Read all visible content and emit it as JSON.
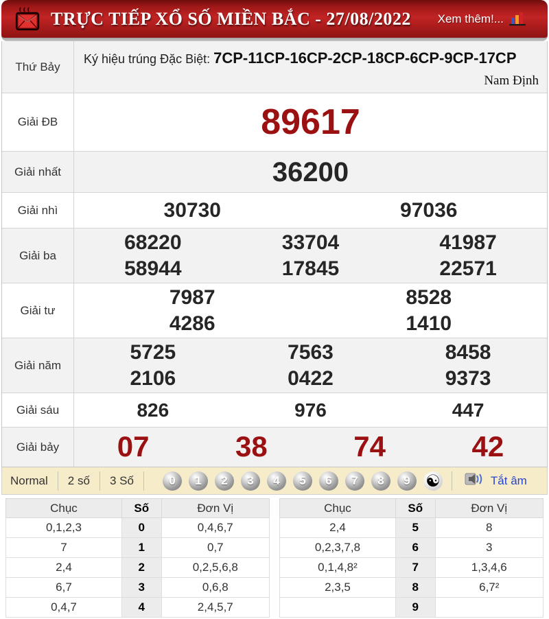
{
  "header": {
    "title": "TRỰC TIẾP XỔ SỐ MIỀN BẮC - 27/08/2022",
    "more_label": "Xem thêm!..."
  },
  "sign_row": {
    "day": "Thứ Bảy",
    "sign_label": "Ký hiệu trúng Đặc Biệt: ",
    "sign_codes": "7CP-11CP-16CP-2CP-18CP-6CP-9CP-17CP",
    "province": "Nam Định"
  },
  "prizes": {
    "db": {
      "label": "Giải ĐB",
      "values": [
        "89617"
      ]
    },
    "nhat": {
      "label": "Giải nhất",
      "values": [
        "36200"
      ]
    },
    "nhi": {
      "label": "Giải nhì",
      "values": [
        "30730",
        "97036"
      ]
    },
    "ba": {
      "label": "Giải ba",
      "values": [
        "68220",
        "33704",
        "41987",
        "58944",
        "17845",
        "22571"
      ]
    },
    "tu": {
      "label": "Giải tư",
      "values": [
        "7987",
        "8528",
        "4286",
        "1410"
      ]
    },
    "nam": {
      "label": "Giải năm",
      "values": [
        "5725",
        "7563",
        "8458",
        "2106",
        "0422",
        "9373"
      ]
    },
    "sau": {
      "label": "Giải sáu",
      "values": [
        "826",
        "976",
        "447"
      ]
    },
    "bay": {
      "label": "Giải bảy",
      "values": [
        "07",
        "38",
        "74",
        "42"
      ]
    }
  },
  "controls": {
    "modes": [
      "Normal",
      "2 số",
      "3 Số"
    ],
    "digits": [
      "0",
      "1",
      "2",
      "3",
      "4",
      "5",
      "6",
      "7",
      "8",
      "9"
    ],
    "yinyang_symbol": "☯",
    "mute_label": "Tắt âm"
  },
  "stats": {
    "headers": {
      "chuc": "Chục",
      "so": "Số",
      "donvi": "Đơn Vị"
    },
    "left": [
      {
        "chuc": "0,1,2,3",
        "so": "0",
        "donvi": "0,4,6,7"
      },
      {
        "chuc": "7",
        "so": "1",
        "donvi": "0,7"
      },
      {
        "chuc": "2,4",
        "so": "2",
        "donvi": "0,2,5,6,8"
      },
      {
        "chuc": "6,7",
        "so": "3",
        "donvi": "0,6,8"
      },
      {
        "chuc": "0,4,7",
        "so": "4",
        "donvi": "2,4,5,7"
      }
    ],
    "right": [
      {
        "chuc": "2,4",
        "so": "5",
        "donvi": "8"
      },
      {
        "chuc": "0,2,3,7,8",
        "so": "6",
        "donvi": "3"
      },
      {
        "chuc": "0,1,4,8²",
        "so": "7",
        "donvi": "1,3,4,6"
      },
      {
        "chuc": "2,3,5",
        "so": "8",
        "donvi": "6,7²"
      },
      {
        "chuc": "",
        "so": "9",
        "donvi": ""
      }
    ]
  },
  "colors": {
    "accent_red": "#9b1111",
    "header_red": "#b51f1f",
    "link_blue": "#2745d0"
  }
}
